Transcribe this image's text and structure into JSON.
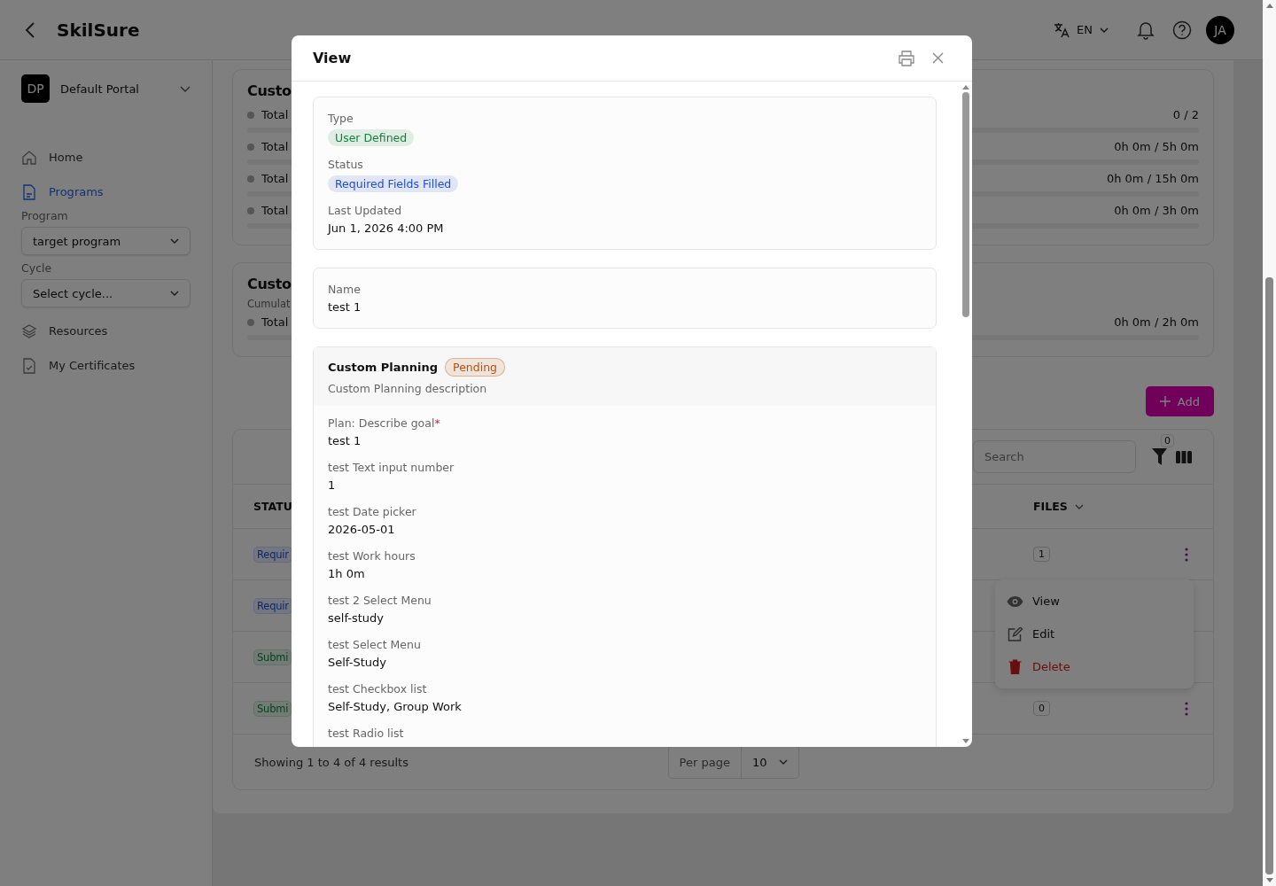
{
  "header": {
    "app_name": "SkilSure",
    "language": "EN",
    "avatar": "JA"
  },
  "sidebar": {
    "portal": {
      "initials": "DP",
      "name": "Default Portal"
    },
    "items": [
      {
        "kind": "link",
        "label": "Home",
        "selected": false
      },
      {
        "kind": "link",
        "label": "Programs",
        "selected": true
      },
      {
        "kind": "select",
        "label": "Program",
        "value": "target program"
      },
      {
        "kind": "select",
        "label": "Cycle",
        "value": "Select cycle..."
      },
      {
        "kind": "link",
        "label": "Resources",
        "selected": false
      },
      {
        "kind": "link",
        "label": "My Certificates",
        "selected": false
      }
    ]
  },
  "summary_cards": [
    {
      "title": "Custo",
      "rows": [
        {
          "label": "Total",
          "reading": "0 / 2",
          "level": 0
        },
        {
          "label": "Total",
          "reading": "0h 0m / 5h 0m",
          "level": 0
        },
        {
          "label": "Total",
          "reading": "0h 0m / 15h 0m",
          "level": 0
        },
        {
          "label": "Total",
          "reading": "0h 0m / 3h 0m",
          "level": 0
        }
      ]
    },
    {
      "title": "Custo",
      "subtitle": "Cumulat",
      "rows": [
        {
          "label": "Total",
          "reading": "0h 0m / 2h 0m",
          "level": 0
        }
      ]
    }
  ],
  "add_button": "Add",
  "table": {
    "search": {
      "placeholder": "Search"
    },
    "filter_count": "0",
    "columns": [
      "STATU",
      "FILES"
    ],
    "rows": [
      {
        "status": {
          "text": "Requir",
          "kind": "required"
        },
        "files": "1"
      },
      {
        "status": {
          "text": "Requir",
          "kind": "required"
        }
      },
      {
        "status": {
          "text": "Submi",
          "kind": "submitted"
        }
      },
      {
        "status": {
          "text": "Submi",
          "kind": "submitted"
        },
        "files": "0"
      }
    ],
    "footer": {
      "summary": "Showing 1 to 4 of 4 results",
      "per_page_label": "Per page",
      "per_page": "10"
    }
  },
  "row_menu": [
    {
      "kind": "view",
      "label": "View"
    },
    {
      "kind": "edit",
      "label": "Edit"
    },
    {
      "kind": "delete",
      "label": "Delete"
    }
  ],
  "modal": {
    "title": "View",
    "sections": [
      {
        "kind": "meta",
        "fields": [
          {
            "label": "Type",
            "badge": {
              "text": "User Defined",
              "color": "#15803d"
            }
          },
          {
            "label": "Status",
            "badge": {
              "text": "Required Fields Filled",
              "color": "#1d4ed8"
            }
          },
          {
            "label": "Last Updated",
            "value": "Jun 1, 2026 4:00 PM"
          }
        ]
      },
      {
        "kind": "plain",
        "fields": [
          {
            "label": "Name",
            "value": "test 1"
          }
        ]
      },
      {
        "kind": "form",
        "title": "Custom Planning",
        "badge": {
          "text": "Pending",
          "color": "#b45309"
        },
        "description": "Custom Planning description",
        "fields": [
          {
            "label": "Plan: Describe goal",
            "required_mark": "*",
            "value": "test 1"
          },
          {
            "label": "test Text input number",
            "value": "1"
          },
          {
            "label": "test Date picker",
            "value": "2026-05-01"
          },
          {
            "label": "test Work hours",
            "value": "1h 0m"
          },
          {
            "label": "test 2 Select Menu",
            "value": "self-study"
          },
          {
            "label": "test Select Menu",
            "value": "Self-Study"
          },
          {
            "label": "test Checkbox list",
            "value": "Self-Study, Group Work"
          },
          {
            "label": "test Radio list"
          }
        ]
      }
    ]
  }
}
